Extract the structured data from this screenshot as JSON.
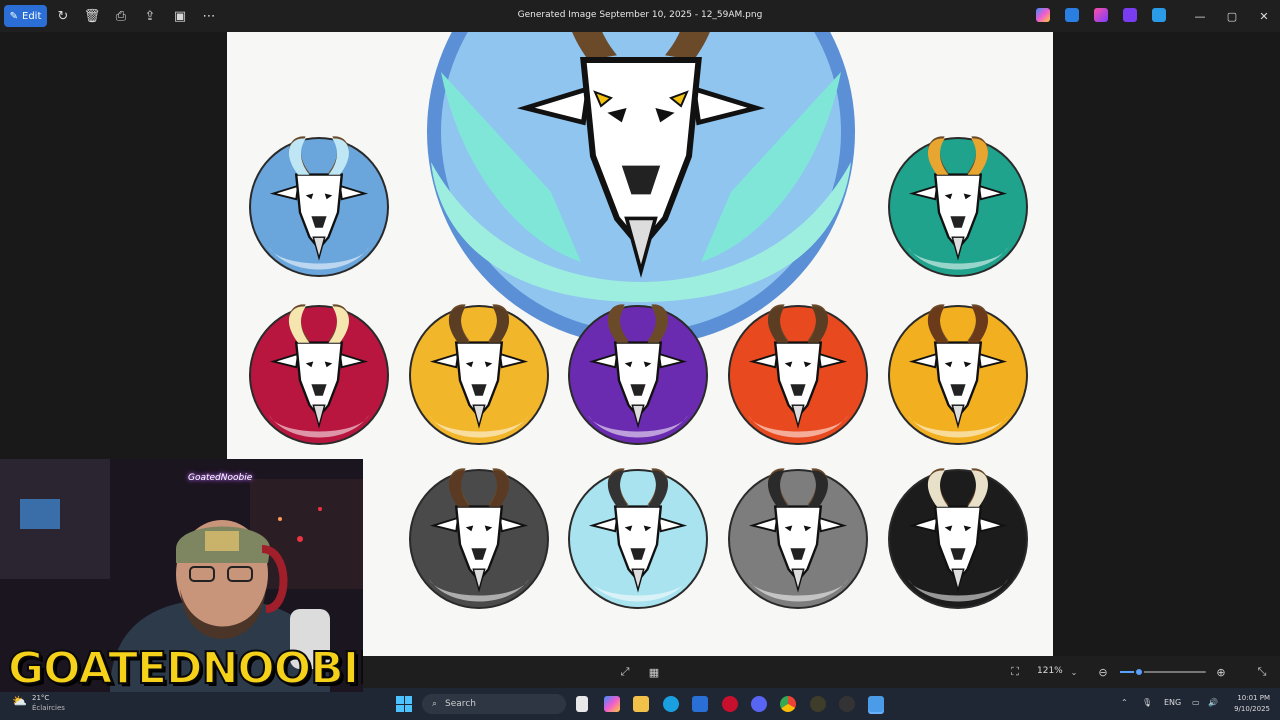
{
  "toolbar": {
    "edit_label": "Edit",
    "file_title": "Generated Image September 10, 2025 - 12_59AM.png"
  },
  "viewer": {
    "zoom_label": "121%",
    "zoom_fraction": 0.22
  },
  "badges": [
    {
      "theme": "ice",
      "bg": "#6aa6dc"
    },
    {
      "theme": "fire-teal",
      "bg": "#1fa38c"
    },
    {
      "theme": "radiant",
      "bg": "#b8163f"
    },
    {
      "theme": "vine-gold",
      "bg": "#f2b62b"
    },
    {
      "theme": "arcane",
      "bg": "#6a2bb0"
    },
    {
      "theme": "vine-fire",
      "bg": "#e8491f"
    },
    {
      "theme": "flame-gold",
      "bg": "#f2b020"
    },
    {
      "theme": "earth",
      "bg": "#4a4a4a"
    },
    {
      "theme": "sky",
      "bg": "#a9e3f0"
    },
    {
      "theme": "cyber",
      "bg": "#7d7d7d"
    },
    {
      "theme": "storm",
      "bg": "#1c1c1c"
    }
  ],
  "webcam": {
    "handle": "GoatedNoobie",
    "logo_part1": "GOATED",
    "logo_part2": "NOOBIE"
  },
  "taskbar": {
    "weather_temp": "21°C",
    "weather_cond": "Éclaircies",
    "search_placeholder": "Search",
    "language": "ENG",
    "time": "10:01 PM",
    "date": "9/10/2025"
  }
}
